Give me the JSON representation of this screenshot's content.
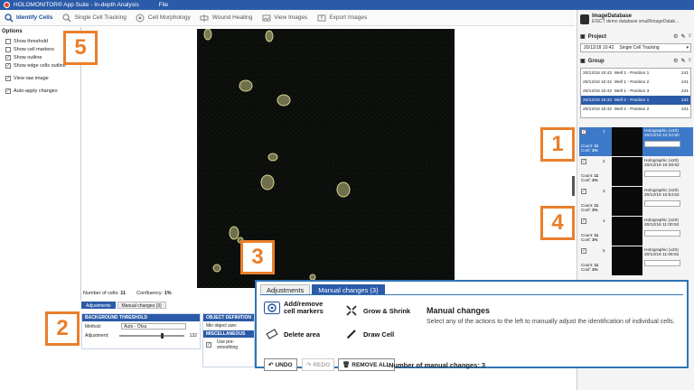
{
  "titlebar": {
    "title": "HOLOMONITOR® App Suite - In-depth Analysis",
    "menu": "File"
  },
  "toolbar": {
    "items": [
      {
        "label": "Identify Cells",
        "icon": "identify-cells-icon",
        "active": true
      },
      {
        "label": "Single Cell Tracking",
        "icon": "tracking-icon"
      },
      {
        "label": "Cell Morphology",
        "icon": "morphology-icon"
      },
      {
        "label": "Wound Healing",
        "icon": "wound-healing-icon"
      },
      {
        "label": "View Images",
        "icon": "view-images-icon"
      },
      {
        "label": "Export Images",
        "icon": "export-images-icon"
      }
    ]
  },
  "options": {
    "header": "Options",
    "items": [
      {
        "label": "Show threshold",
        "checked": false
      },
      {
        "label": "Show cell markers",
        "checked": false
      },
      {
        "label": "Show outline",
        "checked": true
      },
      {
        "label": "Show edge cells outline",
        "checked": true
      }
    ],
    "items2": [
      {
        "label": "View raw image",
        "checked": true
      }
    ],
    "items3": [
      {
        "label": "Auto-apply changes",
        "checked": true
      }
    ]
  },
  "stats": {
    "cells_label": "Number of cells:",
    "cells_value": "11",
    "confluency_label": "Confluency:",
    "confluency_value": "1%"
  },
  "bottom": {
    "tabs": [
      "Adjustments",
      "Manual changes (3)"
    ],
    "bg_header": "BACKGROUND THRESHOLD",
    "method_label": "Method:",
    "method_value": "Auto - Otsu",
    "adjustment_label": "Adjustment:",
    "adjustment_value": "132",
    "objdef_header": "OBJECT DEFINITION",
    "min_size_label": "Min object size:",
    "misc_header": "MISCELLANEOUS",
    "preproc_label": "Use pre-smoothing"
  },
  "right": {
    "db_title": "ImageDatabase",
    "db_sub": "EISCT demo database small\\ImageDatab...",
    "project_label": "Project",
    "project_date": "20/12/18 10:42",
    "project_name": "Single Cell Tracking",
    "group_label": "Group",
    "groups": [
      {
        "date": "20/12/18 10:42",
        "well": "Well 1 - Position 1",
        "n": "241",
        "sel": false
      },
      {
        "date": "20/12/18 10:42",
        "well": "Well 1 - Position 2",
        "n": "241",
        "sel": false
      },
      {
        "date": "20/12/18 10:42",
        "well": "Well 1 - Position 3",
        "n": "241",
        "sel": false
      },
      {
        "date": "20/12/18 10:42",
        "well": "Well 2 - Position 1",
        "n": "241",
        "sel": true
      },
      {
        "date": "20/12/18 10:42",
        "well": "Well 2 - Position 2",
        "n": "241",
        "sel": false
      }
    ],
    "frames": [
      {
        "num": "1",
        "count": "11",
        "conf": "1%",
        "type": "Holographic (x20)",
        "time": "20/12/18 10:42:50",
        "sel": true
      },
      {
        "num": "2",
        "count": "11",
        "conf": "1%",
        "type": "Holographic (x20)",
        "time": "20/12/18 10:48:52",
        "sel": false
      },
      {
        "num": "3",
        "count": "11",
        "conf": "1%",
        "type": "Holographic (x20)",
        "time": "20/12/18 10:54:52",
        "sel": false
      },
      {
        "num": "4",
        "count": "11",
        "conf": "1%",
        "type": "Holographic (x20)",
        "time": "20/12/18 11:00:52",
        "sel": false
      },
      {
        "num": "5",
        "count": "11",
        "conf": "1%",
        "type": "Holographic (x20)",
        "time": "20/12/18 11:06:52",
        "sel": false
      }
    ],
    "count_label": "Count:",
    "conf_label": "Conf:"
  },
  "badges": [
    "1",
    "2",
    "3",
    "4",
    "5"
  ],
  "zoom": {
    "tabs": [
      "Adjustments",
      "Manual changes (3)"
    ],
    "add_remove": "Add/remove cell markers",
    "grow_shrink": "Grow & Shrink",
    "delete_area": "Delete area",
    "draw_cell": "Draw Cell",
    "title": "Manual changes",
    "desc": "Select any of the actions to the left to manually adjust the identification of individual cells.",
    "undo": "UNDO",
    "redo": "REDO",
    "remove_all": "REMOVE ALL",
    "num_changes": "Number of manual changes: 3"
  },
  "colors": {
    "accent": "#2b5ba8",
    "badge": "#e97f2b",
    "cell_outline": "#d8d58a"
  }
}
